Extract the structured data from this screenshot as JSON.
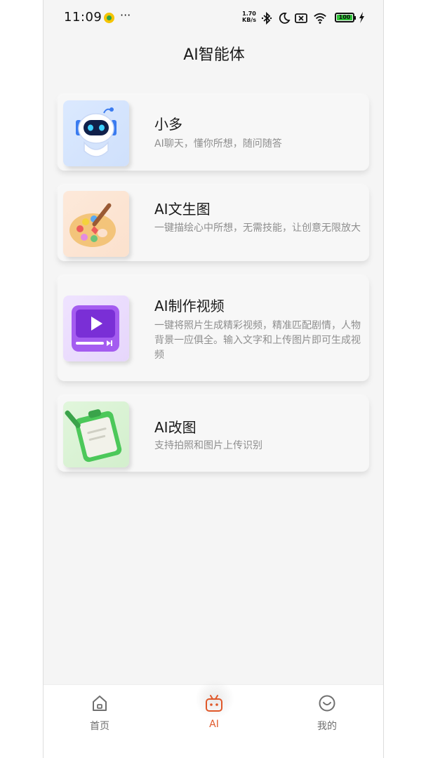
{
  "status_bar": {
    "time": "11:09",
    "dots": "···",
    "speed_value": "1.70",
    "speed_unit": "KB/s",
    "battery": "100"
  },
  "header": {
    "title": "AI智能体"
  },
  "cards": [
    {
      "title": "小多",
      "description": "AI聊天，懂你所想，随问随答",
      "icon": "robot-icon"
    },
    {
      "title": "AI文生图",
      "description": "一键描绘心中所想，无需技能，让创意无限放大",
      "icon": "palette-icon"
    },
    {
      "title": "AI制作视频",
      "description": "一键将照片生成精彩视频，精准匹配剧情，人物 背景一应俱全。输入文字和上传图片即可生成视频",
      "icon": "video-icon"
    },
    {
      "title": "AI改图",
      "description": "支持拍照和图片上传识别",
      "icon": "clipboard-edit-icon"
    }
  ],
  "bottom_nav": {
    "items": [
      {
        "label": "首页",
        "icon": "home-icon"
      },
      {
        "label": "AI",
        "icon": "tv-robot-icon"
      },
      {
        "label": "我的",
        "icon": "face-icon"
      }
    ],
    "active_index": 1,
    "active_color": "#e0582a"
  }
}
